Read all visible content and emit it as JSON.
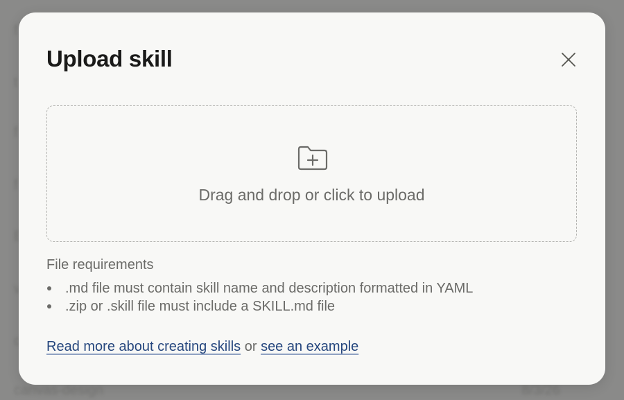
{
  "background": {
    "rows": [
      "f",
      "t",
      "f",
      "f",
      "E",
      "v",
      "c",
      "canvas-design"
    ],
    "visible_date": "8/3/26"
  },
  "modal": {
    "title": "Upload skill",
    "close_icon": "close-icon",
    "dropzone": {
      "icon": "folder-plus-icon",
      "text": "Drag and drop or click to upload"
    },
    "requirements": {
      "heading": "File requirements",
      "items": [
        ".md file must contain skill name and description formatted in YAML",
        ".zip or .skill file must include a SKILL.md file"
      ]
    },
    "footer": {
      "link1": "Read more about creating skills",
      "connector": "or",
      "link2": "see an example"
    }
  },
  "colors": {
    "backdrop": "#8a8a89",
    "modal_bg": "#f8f8f6",
    "title": "#1a1a19",
    "muted_text": "#6b6b68",
    "link": "#26477e",
    "dashed_border": "#b4b4b1"
  }
}
